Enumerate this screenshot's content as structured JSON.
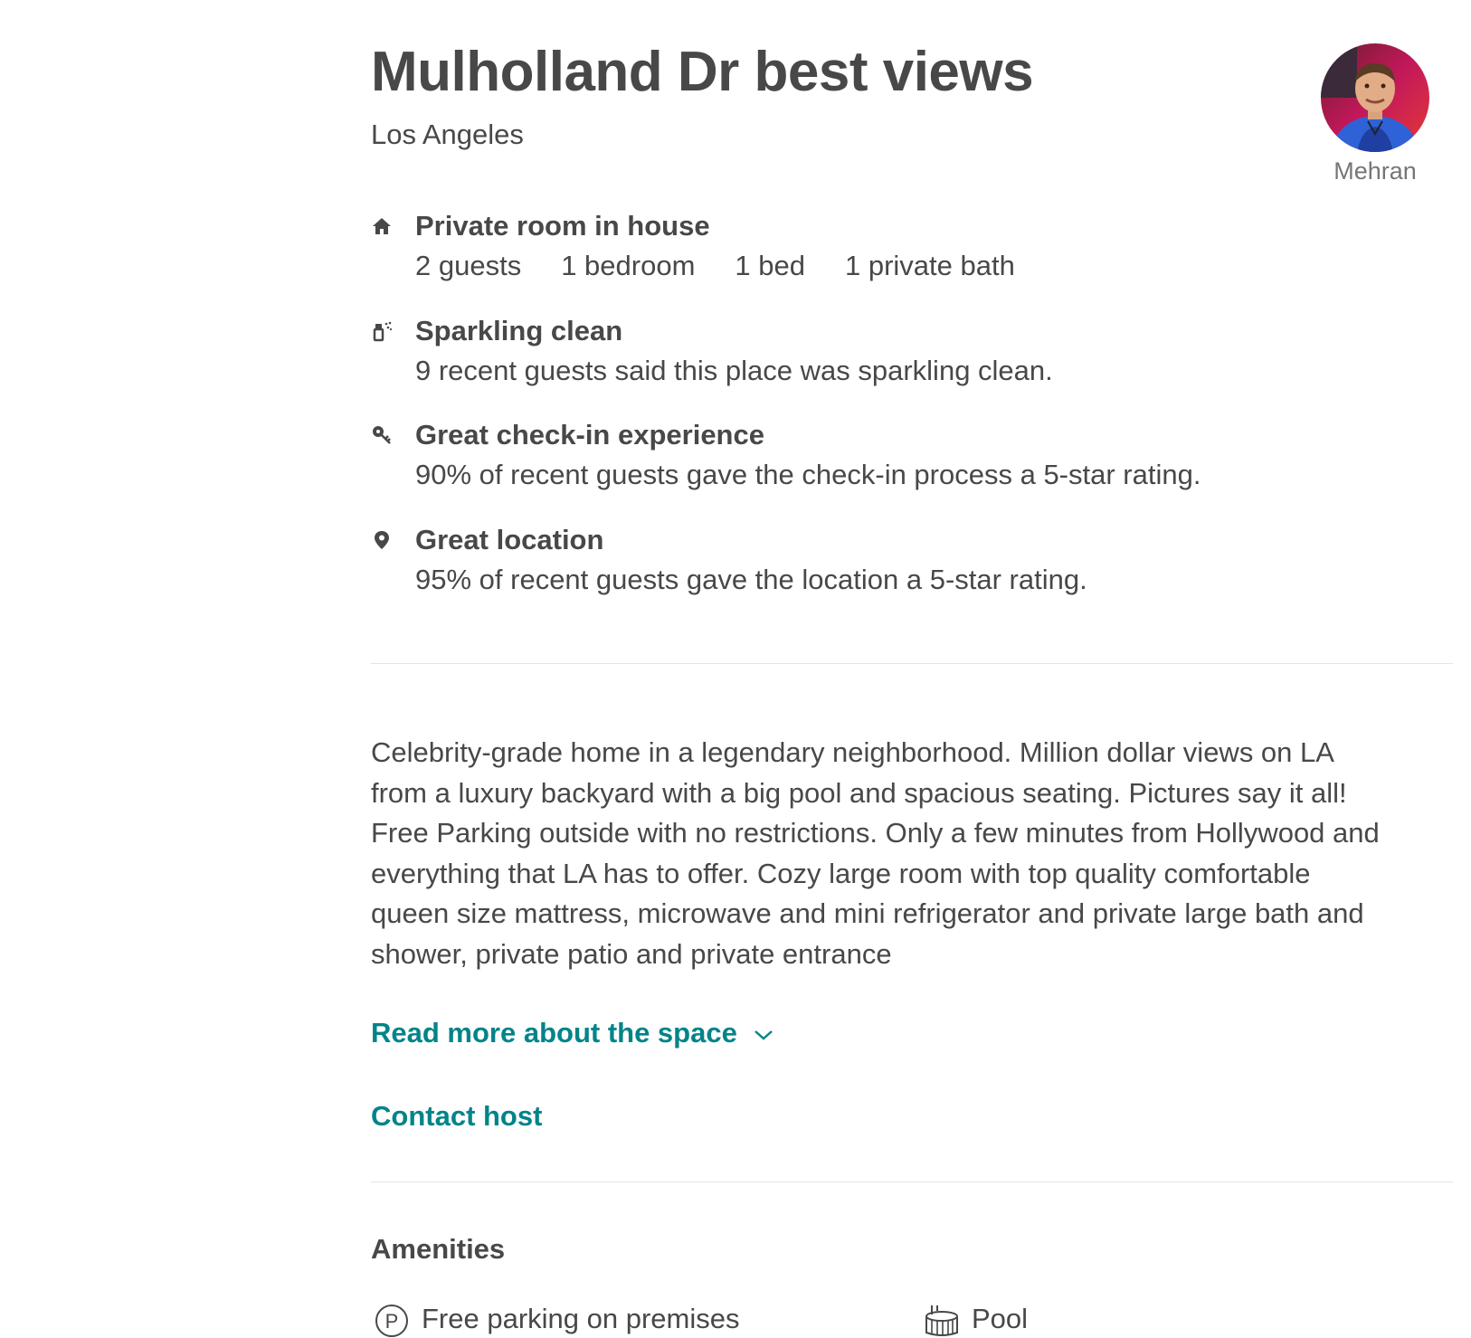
{
  "listing": {
    "title": "Mulholland Dr best views",
    "city": "Los Angeles"
  },
  "host": {
    "name": "Mehran",
    "avatar_icon": "host-avatar-photo"
  },
  "highlights": [
    {
      "icon": "home-icon",
      "title": "Private room in house",
      "details": [
        "2 guests",
        "1 bedroom",
        "1 bed",
        "1 private bath"
      ]
    },
    {
      "icon": "spray-bottle-icon",
      "title": "Sparkling clean",
      "description": "9 recent guests said this place was sparkling clean."
    },
    {
      "icon": "key-icon",
      "title": "Great check-in experience",
      "description": "90% of recent guests gave the check-in process a 5-star rating."
    },
    {
      "icon": "map-pin-icon",
      "title": "Great location",
      "description": "95% of recent guests gave the location a 5-star rating."
    }
  ],
  "description": {
    "lines": [
      "Celebrity-grade home in a legendary neighborhood. Million dollar views on LA",
      "from a luxury backyard with a big pool and spacious seating. Pictures say it all!",
      "Free Parking outside with no restrictions. Only a few minutes from Hollywood and",
      "everything that LA has to offer. Cozy large room with top quality comfortable",
      "queen size mattress, microwave and mini refrigerator and private large bath and",
      "shower, private patio and private entrance"
    ],
    "read_more_label": "Read more about the space",
    "contact_host_label": "Contact host"
  },
  "amenities": {
    "heading": "Amenities",
    "items": [
      {
        "icon": "parking-icon",
        "label": "Free parking on premises"
      },
      {
        "icon": "pool-icon",
        "label": "Pool"
      }
    ]
  },
  "colors": {
    "text": "#484848",
    "muted": "#767676",
    "link": "#008489",
    "divider": "#e4e4e4"
  }
}
